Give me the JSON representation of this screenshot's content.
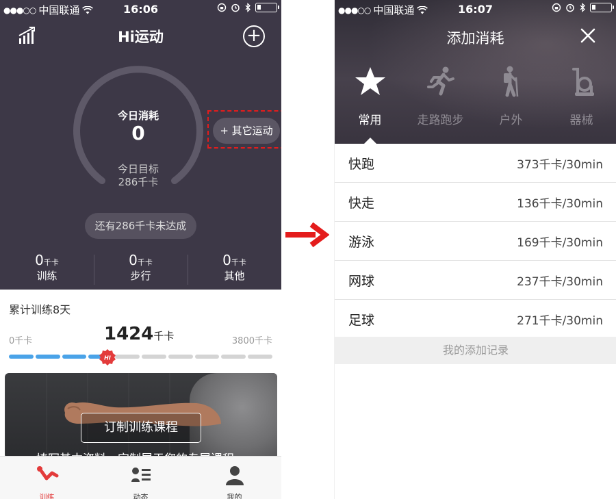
{
  "left": {
    "status": {
      "carrier": "中国联通",
      "signal": "●●●○○",
      "time": "16:06"
    },
    "header": {
      "title": "Hi运动"
    },
    "ring": {
      "consume_label": "今日消耗",
      "consume_value": "0",
      "goal_label": "今日目标",
      "goal_value": "286千卡"
    },
    "other_sport_button": "+ 其它运动",
    "remaining_text": "还有286千卡未达成",
    "breakdown": [
      {
        "value": "0",
        "unit": "千卡",
        "label": "训练"
      },
      {
        "value": "0",
        "unit": "千卡",
        "label": "步行"
      },
      {
        "value": "0",
        "unit": "千卡",
        "label": "其他"
      }
    ],
    "accumulated": "累计训练8天",
    "scale": {
      "min": "0千卡",
      "max": "3800千卡",
      "total": "1424",
      "total_unit": "千卡",
      "progress_fraction": 0.375,
      "badge_text": "HI"
    },
    "banner": {
      "cta": "订制训练课程",
      "subtitle": "填写基本资料，定制属于您的专属课程"
    },
    "tabbar": [
      {
        "label": "训练",
        "icon": "training-icon",
        "active": true
      },
      {
        "label": "动态",
        "icon": "feed-icon",
        "active": false
      },
      {
        "label": "我的",
        "icon": "profile-icon",
        "active": false
      }
    ]
  },
  "right": {
    "status": {
      "carrier": "中国联通",
      "signal": "●●●○○",
      "time": "16:07"
    },
    "header": {
      "title": "添加消耗"
    },
    "categories": [
      {
        "label": "常用",
        "icon": "star-icon",
        "active": true
      },
      {
        "label": "走路跑步",
        "icon": "running-icon",
        "active": false
      },
      {
        "label": "户外",
        "icon": "hiking-icon",
        "active": false
      },
      {
        "label": "器械",
        "icon": "exercise-bike-icon",
        "active": false
      }
    ],
    "activities": [
      {
        "name": "快跑",
        "value": "373千卡/30min"
      },
      {
        "name": "快走",
        "value": "136千卡/30min"
      },
      {
        "name": "游泳",
        "value": "169千卡/30min"
      },
      {
        "name": "网球",
        "value": "237千卡/30min"
      },
      {
        "name": "足球",
        "value": "271千卡/30min"
      }
    ],
    "history_button": "我的添加记录"
  },
  "colors": {
    "dark_bg": "#3d3847",
    "accent_red": "#e33b3b",
    "progress_blue": "#4aa3e8",
    "annotation_red": "#e41c1c"
  }
}
